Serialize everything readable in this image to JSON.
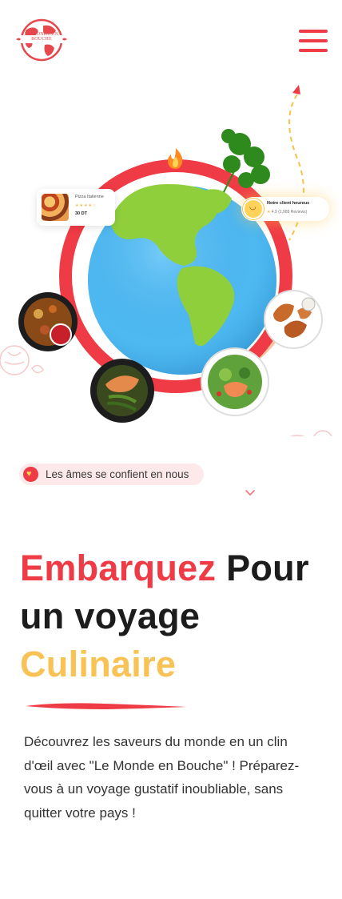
{
  "brand": {
    "logo_text": "LE MONDE EN BOUCHE"
  },
  "menu": {
    "icon": "hamburger-menu-icon"
  },
  "hero": {
    "pizza_card": {
      "title": "Pizza Italienne",
      "stars": "★★★★☆",
      "price": "30 DT"
    },
    "client_card": {
      "title": "Notre client heureux",
      "stars": "★",
      "rating": "4.9 (1,989 Reviews)"
    }
  },
  "badge": {
    "text": "Les âmes se confient en nous",
    "icon": "heart-icon"
  },
  "heading": {
    "word1": "Embarquez",
    "word2": " Pour",
    "line2": "un voyage",
    "line3": "Culinaire"
  },
  "description": "Découvrez les saveurs du monde en un clin d'œil avec \"Le Monde en Bouche\" ! Préparez-vous à un voyage gustatif inoubliable, sans quitter votre pays !",
  "colors": {
    "accent_red": "#ef3b45",
    "accent_yellow": "#f8c255",
    "ocean": "#4eb8f0",
    "land": "#8fcf3c"
  }
}
